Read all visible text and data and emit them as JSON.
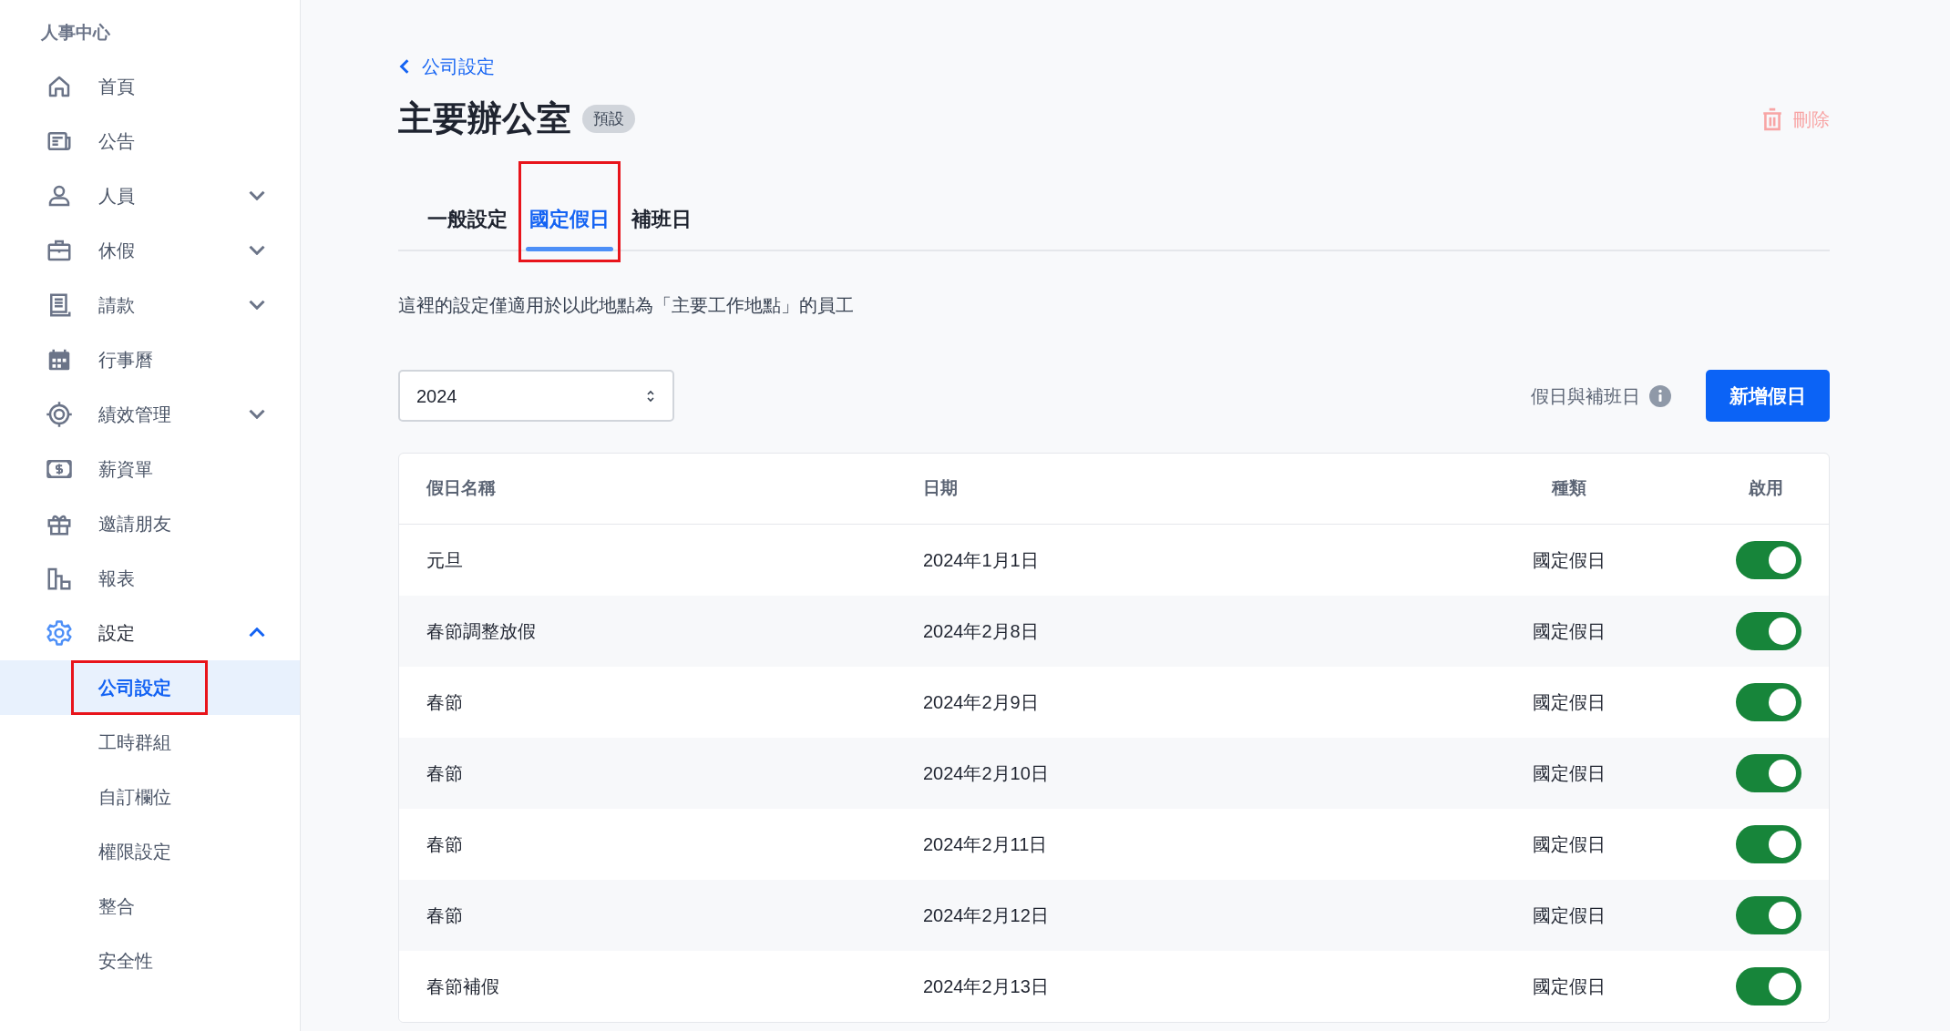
{
  "sidebar": {
    "title": "人事中心",
    "items": [
      {
        "label": "首頁",
        "selected": false
      },
      {
        "label": "公告",
        "selected": false
      },
      {
        "label": "人員",
        "selected": false,
        "expanded": false
      },
      {
        "label": "休假",
        "selected": false,
        "expanded": false
      },
      {
        "label": "請款",
        "selected": false,
        "expanded": false
      },
      {
        "label": "行事曆",
        "selected": false
      },
      {
        "label": "績效管理",
        "selected": false,
        "expanded": false
      },
      {
        "label": "薪資單",
        "selected": false
      },
      {
        "label": "邀請朋友",
        "selected": false
      },
      {
        "label": "報表",
        "selected": false
      },
      {
        "label": "設定",
        "selected": true,
        "expanded": true,
        "children": [
          {
            "label": "公司設定",
            "selected": true,
            "annotated": true
          },
          {
            "label": "工時群組",
            "selected": false,
            "annotated": false
          },
          {
            "label": "自訂欄位",
            "selected": false,
            "annotated": false
          },
          {
            "label": "權限設定",
            "selected": false,
            "annotated": false
          },
          {
            "label": "整合",
            "selected": false,
            "annotated": false
          },
          {
            "label": "安全性",
            "selected": false,
            "annotated": false
          }
        ]
      }
    ]
  },
  "breadcrumb": "公司設定",
  "title": "主要辦公室",
  "badge": "預設",
  "delete_button": "刪除",
  "tabs": [
    {
      "label": "一般設定",
      "selected": false,
      "annotated": false
    },
    {
      "label": "國定假日",
      "selected": true,
      "annotated": true
    },
    {
      "label": "補班日",
      "selected": false,
      "annotated": false
    }
  ],
  "note": "這裡的設定僅適用於以此地點為「主要工作地點」的員工",
  "year_select": "2024",
  "legend_label": "假日與補班日",
  "add_button": "新增假日",
  "table": {
    "columns": [
      "假日名稱",
      "日期",
      "種類",
      "啟用"
    ],
    "rows": [
      {
        "name": "元旦",
        "date": "2024年1月1日",
        "type": "國定假日",
        "on": true
      },
      {
        "name": "春節調整放假",
        "date": "2024年2月8日",
        "type": "國定假日",
        "on": true
      },
      {
        "name": "春節",
        "date": "2024年2月9日",
        "type": "國定假日",
        "on": true
      },
      {
        "name": "春節",
        "date": "2024年2月10日",
        "type": "國定假日",
        "on": true
      },
      {
        "name": "春節",
        "date": "2024年2月11日",
        "type": "國定假日",
        "on": true
      },
      {
        "name": "春節",
        "date": "2024年2月12日",
        "type": "國定假日",
        "on": true
      },
      {
        "name": "春節補假",
        "date": "2024年2月13日",
        "type": "國定假日",
        "on": true
      }
    ]
  }
}
